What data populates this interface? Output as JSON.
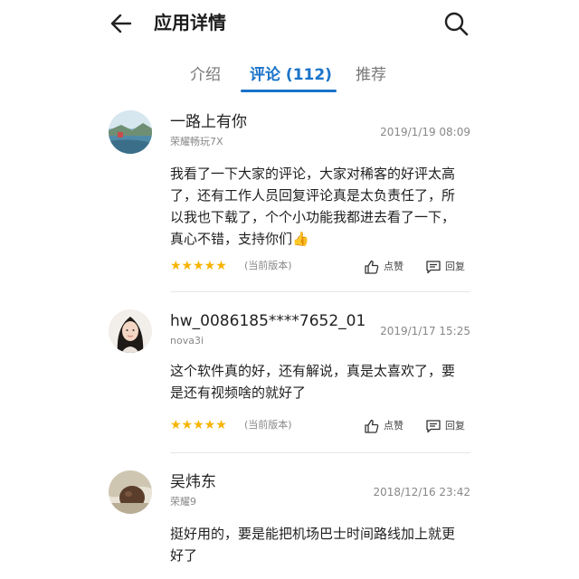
{
  "header": {
    "title": "应用详情",
    "back_icon": "arrow-left-icon",
    "search_icon": "search-icon"
  },
  "tabs": [
    {
      "label": "介绍",
      "active": false
    },
    {
      "label": "评论 (112)",
      "active": true
    },
    {
      "label": "推荐",
      "active": false
    }
  ],
  "colors": {
    "accent": "#1a73c9",
    "star": "#f6b400"
  },
  "comments": [
    {
      "user": "一路上有你",
      "device": "荣耀畅玩7X",
      "date": "2019/1/19 08:09",
      "text": "我看了一下大家的评论，大家对稀客的好评太高了，还有工作人员回复评论真是太负责任了，所以我也下载了，个个小功能我都进去看了一下，真心不错，支持你们👍",
      "rating": 5,
      "stars": "★★★★★",
      "version_tag": "(当前版本)",
      "like_label": "点赞",
      "reply_label": "回复"
    },
    {
      "user": "hw_0086185****7652_01",
      "device": "nova3i",
      "date": "2019/1/17 15:25",
      "text": "这个软件真的好，还有解说，真是太喜欢了，要是还有视频啥的就好了",
      "rating": 5,
      "stars": "★★★★★",
      "version_tag": "(当前版本)",
      "like_label": "点赞",
      "reply_label": "回复"
    },
    {
      "user": "吴炜东",
      "device": "荣耀9",
      "date": "2018/12/16 23:42",
      "text": "挺好用的，要是能把机场巴士时间路线加上就更好了"
    }
  ]
}
